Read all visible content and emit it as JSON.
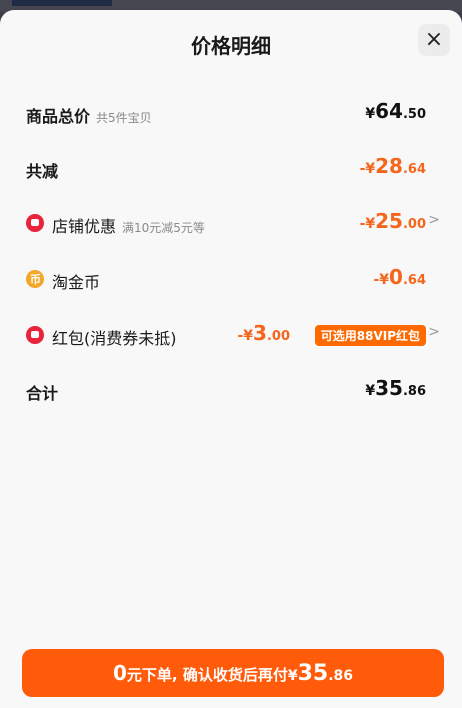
{
  "header": {
    "title": "价格明细",
    "close_icon": "close-icon"
  },
  "rows": {
    "total": {
      "label": "商品总价",
      "sub": "共5件宝贝",
      "currency": "¥",
      "int": "64",
      "dec": ".50"
    },
    "reduce": {
      "label": "共减",
      "currency": "-¥",
      "int": "28",
      "dec": ".64"
    },
    "shop": {
      "label": "店铺优惠",
      "sub": "满10元减5元等",
      "currency": "-¥",
      "int": "25",
      "dec": ".00",
      "icon": "shop-coupon-icon"
    },
    "coin": {
      "label": "淘金币",
      "currency": "-¥",
      "int": "0",
      "dec": ".64",
      "icon_glyph": "币",
      "icon": "taojinbi-coin-icon"
    },
    "redpack": {
      "label": "红包(消费券未抵)",
      "currency": "-¥",
      "int": "3",
      "dec": ".00",
      "badge": "可选用88VIP红包",
      "icon": "red-packet-icon"
    },
    "sum": {
      "label": "合计",
      "currency": "¥",
      "int": "35",
      "dec": ".86"
    }
  },
  "button": {
    "zero": "0",
    "text": "元下单, 确认收货后再付",
    "currency": "¥",
    "int": "35",
    "dec": ".86"
  },
  "colors": {
    "accent": "#f4661b",
    "button": "#ff5b0a"
  }
}
